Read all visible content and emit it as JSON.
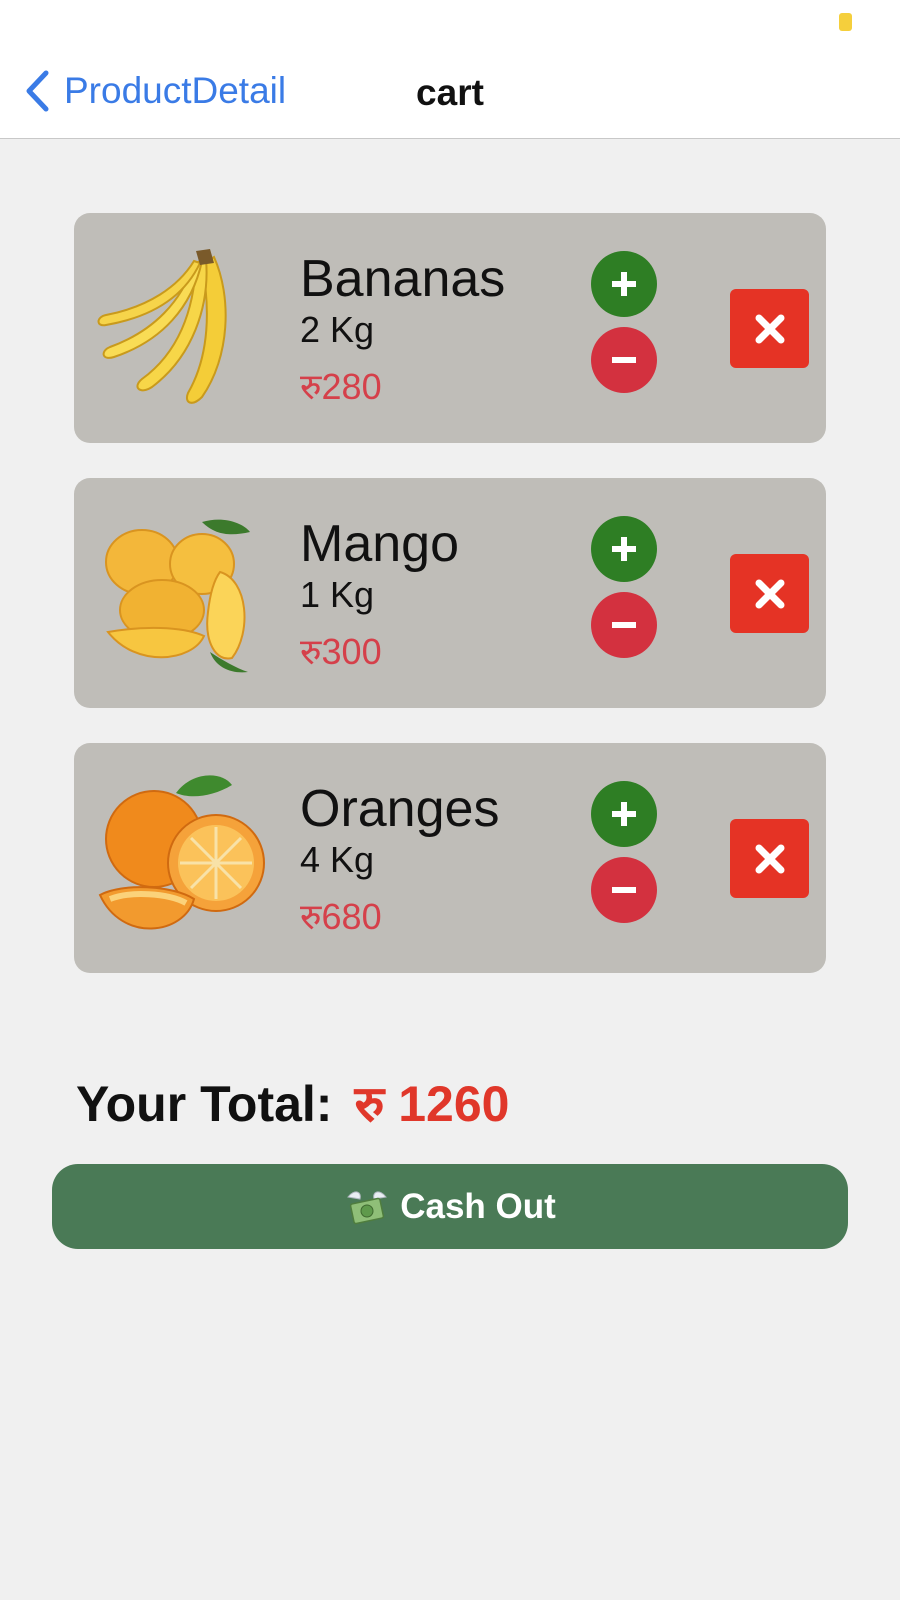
{
  "colors": {
    "accent": "#3a7be6",
    "card_bg": "#bfbdb8",
    "plus": "#2e7e24",
    "minus": "#d3313f",
    "remove": "#e53325",
    "price": "#d5404a",
    "total": "#e0372a",
    "cashout": "#4a7a56"
  },
  "nav": {
    "back_label": "ProductDetail",
    "back_icon": "chevron-left-icon",
    "title": "cart"
  },
  "cart": {
    "items": [
      {
        "name": "Bananas",
        "quantity": "2 Kg",
        "price": "रु280",
        "image": "bananas-image"
      },
      {
        "name": "Mango",
        "quantity": "1 Kg",
        "price": "रु300",
        "image": "mango-image"
      },
      {
        "name": "Oranges",
        "quantity": "4 Kg",
        "price": "रु680",
        "image": "oranges-image"
      }
    ],
    "increase_icon": "plus-icon",
    "decrease_icon": "minus-icon",
    "remove_icon": "close-icon"
  },
  "summary": {
    "total_label": "Your Total:",
    "total_value": "रु 1260"
  },
  "checkout": {
    "label": "Cash Out",
    "icon": "money-with-wings-icon"
  }
}
